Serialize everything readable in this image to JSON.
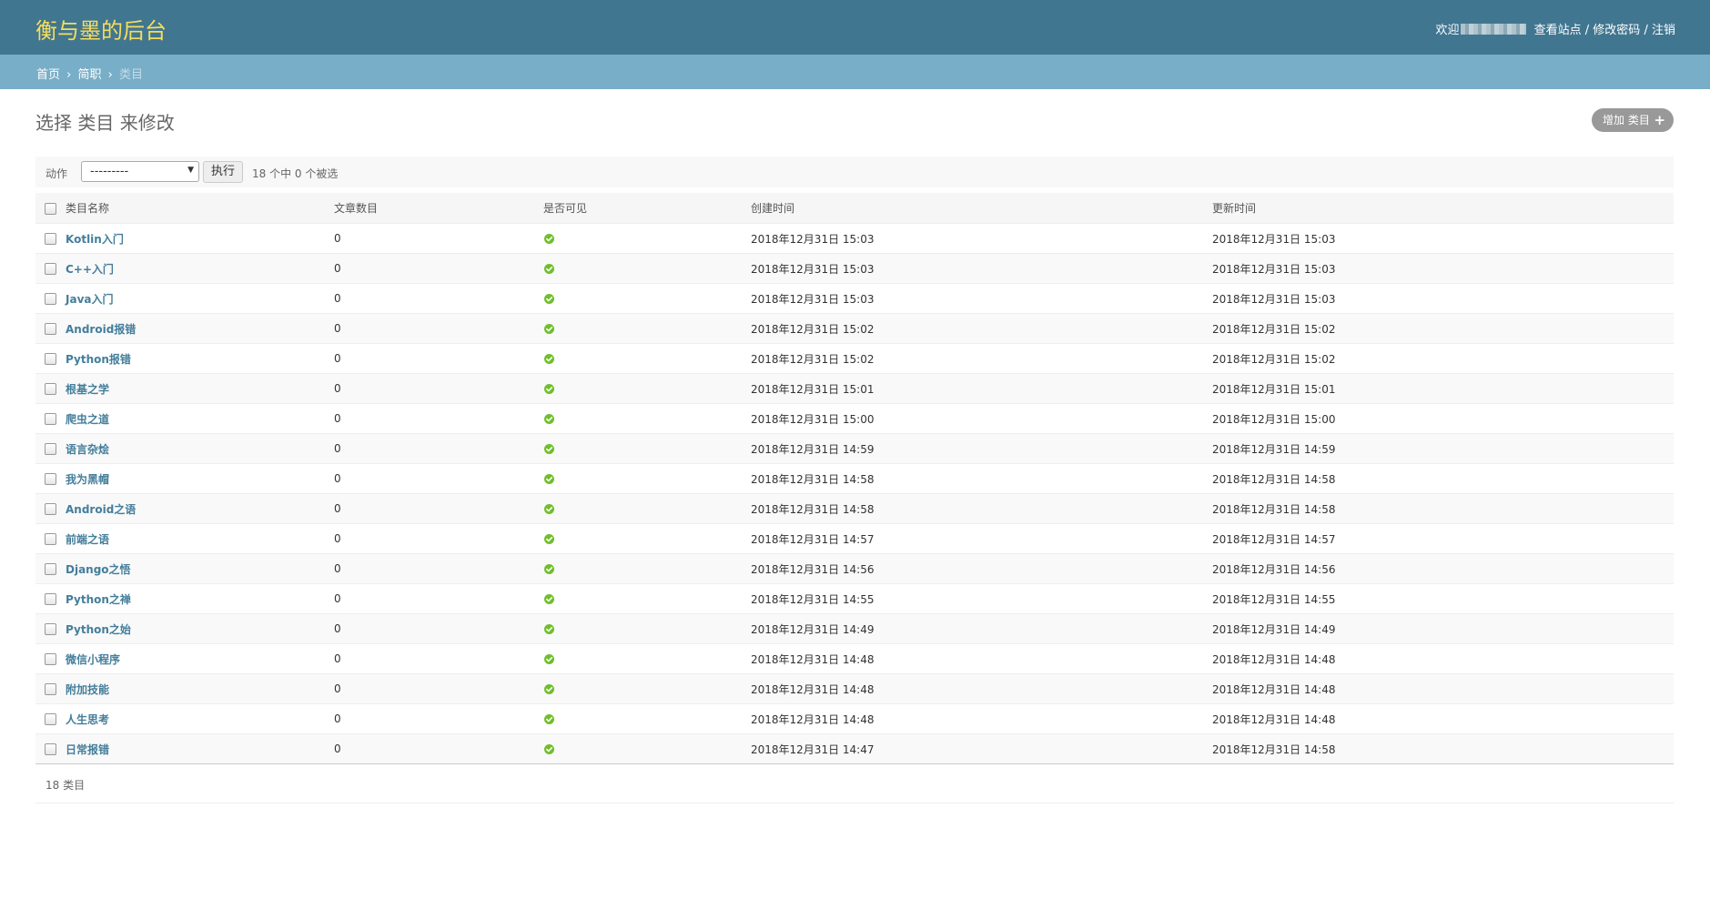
{
  "header": {
    "site_title": "衡与墨的后台",
    "welcome": "欢迎",
    "view_site": "查看站点",
    "change_password": "修改密码",
    "logout": "注销",
    "separator": "/"
  },
  "breadcrumbs": {
    "home": "首页",
    "app": "简职",
    "current": "类目",
    "separator": "›"
  },
  "page": {
    "heading": "选择 类目 来修改",
    "add_button": "增加 类目",
    "add_icon": "plus-icon"
  },
  "actions": {
    "label": "动作",
    "select_value": "---------",
    "go_button": "执行",
    "selection_count": "18 个中 0 个被选"
  },
  "table": {
    "columns": [
      "类目名称",
      "文章数目",
      "是否可见",
      "创建时间",
      "更新时间"
    ],
    "rows": [
      {
        "name": "Kotlin入门",
        "count": "0",
        "visible": true,
        "created": "2018年12月31日 15:03",
        "updated": "2018年12月31日 15:03"
      },
      {
        "name": "C++入门",
        "count": "0",
        "visible": true,
        "created": "2018年12月31日 15:03",
        "updated": "2018年12月31日 15:03"
      },
      {
        "name": "Java入门",
        "count": "0",
        "visible": true,
        "created": "2018年12月31日 15:03",
        "updated": "2018年12月31日 15:03"
      },
      {
        "name": "Android报错",
        "count": "0",
        "visible": true,
        "created": "2018年12月31日 15:02",
        "updated": "2018年12月31日 15:02"
      },
      {
        "name": "Python报错",
        "count": "0",
        "visible": true,
        "created": "2018年12月31日 15:02",
        "updated": "2018年12月31日 15:02"
      },
      {
        "name": "根基之学",
        "count": "0",
        "visible": true,
        "created": "2018年12月31日 15:01",
        "updated": "2018年12月31日 15:01"
      },
      {
        "name": "爬虫之道",
        "count": "0",
        "visible": true,
        "created": "2018年12月31日 15:00",
        "updated": "2018年12月31日 15:00"
      },
      {
        "name": "语言杂烩",
        "count": "0",
        "visible": true,
        "created": "2018年12月31日 14:59",
        "updated": "2018年12月31日 14:59"
      },
      {
        "name": "我为黑帽",
        "count": "0",
        "visible": true,
        "created": "2018年12月31日 14:58",
        "updated": "2018年12月31日 14:58"
      },
      {
        "name": "Android之语",
        "count": "0",
        "visible": true,
        "created": "2018年12月31日 14:58",
        "updated": "2018年12月31日 14:58"
      },
      {
        "name": "前端之语",
        "count": "0",
        "visible": true,
        "created": "2018年12月31日 14:57",
        "updated": "2018年12月31日 14:57"
      },
      {
        "name": "Django之悟",
        "count": "0",
        "visible": true,
        "created": "2018年12月31日 14:56",
        "updated": "2018年12月31日 14:56"
      },
      {
        "name": "Python之禅",
        "count": "0",
        "visible": true,
        "created": "2018年12月31日 14:55",
        "updated": "2018年12月31日 14:55"
      },
      {
        "name": "Python之始",
        "count": "0",
        "visible": true,
        "created": "2018年12月31日 14:49",
        "updated": "2018年12月31日 14:49"
      },
      {
        "name": "微信小程序",
        "count": "0",
        "visible": true,
        "created": "2018年12月31日 14:48",
        "updated": "2018年12月31日 14:48"
      },
      {
        "name": "附加技能",
        "count": "0",
        "visible": true,
        "created": "2018年12月31日 14:48",
        "updated": "2018年12月31日 14:48"
      },
      {
        "name": "人生思考",
        "count": "0",
        "visible": true,
        "created": "2018年12月31日 14:48",
        "updated": "2018年12月31日 14:48"
      },
      {
        "name": "日常报错",
        "count": "0",
        "visible": true,
        "created": "2018年12月31日 14:47",
        "updated": "2018年12月31日 14:58"
      }
    ]
  },
  "footer": {
    "result_count": "18 类目"
  },
  "colors": {
    "header_bg": "#417690",
    "title": "#f5dd5d",
    "breadcrumb_bg": "#79aec8",
    "link": "#447e9b",
    "yes_icon": "#70bf2b"
  }
}
